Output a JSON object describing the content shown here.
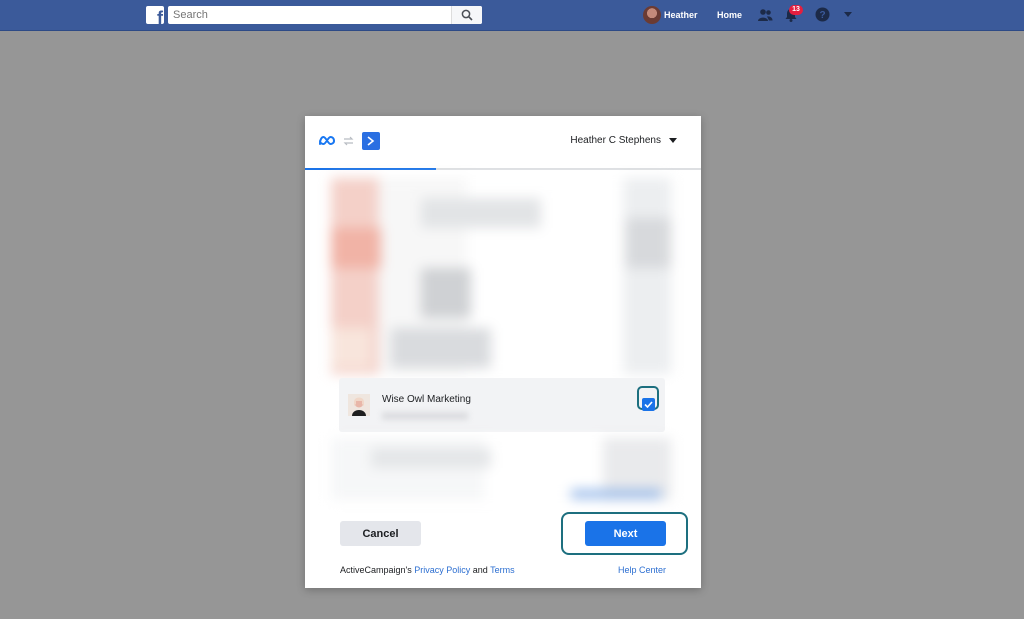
{
  "topbar": {
    "search_placeholder": "Search",
    "user_name": "Heather",
    "home_label": "Home",
    "notification_count": "13"
  },
  "modal": {
    "account_name": "Heather C Stephens",
    "progress_fraction": 0.33,
    "page_item": {
      "name": "Wise Owl Marketing",
      "checked": true
    },
    "buttons": {
      "cancel": "Cancel",
      "next": "Next"
    },
    "footer": {
      "owner_text": "ActiveCampaign's",
      "privacy_link": "Privacy Policy",
      "and_text": "and",
      "terms_link": "Terms",
      "help_link": "Help Center"
    }
  },
  "colors": {
    "brand_blue": "#3b5a9a",
    "primary_button": "#1a73e8",
    "highlight_teal": "#1d6f7f",
    "badge_red": "#e41e3f"
  },
  "icons": [
    "facebook-logo-icon",
    "search-icon",
    "friends-icon",
    "bell-icon",
    "help-icon",
    "caret-down-icon",
    "meta-logo-icon",
    "swap-icon",
    "app-arrow-icon",
    "checkmark-icon"
  ]
}
